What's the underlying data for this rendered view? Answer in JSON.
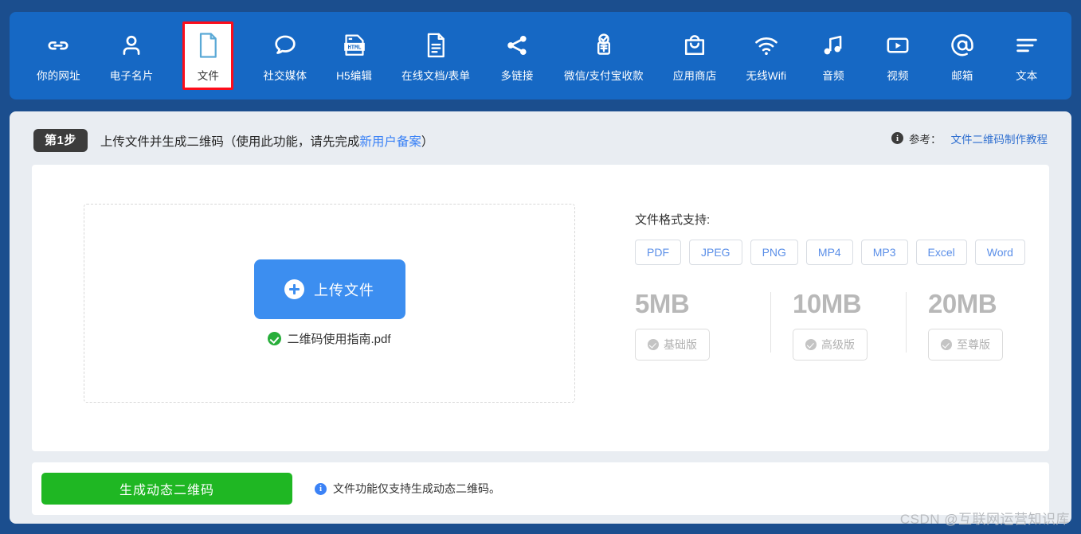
{
  "nav": {
    "items": [
      {
        "label": "你的网址",
        "icon": "link-icon",
        "selected": false
      },
      {
        "label": "电子名片",
        "icon": "person-icon",
        "selected": false
      },
      {
        "label": "文件",
        "icon": "document-icon",
        "selected": true
      },
      {
        "label": "社交媒体",
        "icon": "chat-bubble-icon",
        "selected": false
      },
      {
        "label": "H5编辑",
        "icon": "html-file-icon",
        "selected": false
      },
      {
        "label": "在线文档/表单",
        "icon": "text-document-icon",
        "selected": false
      },
      {
        "label": "多链接",
        "icon": "share-nodes-icon",
        "selected": false
      },
      {
        "label": "微信/支付宝收款",
        "icon": "payment-check-icon",
        "selected": false
      },
      {
        "label": "应用商店",
        "icon": "shopping-bag-icon",
        "selected": false
      },
      {
        "label": "无线Wifi",
        "icon": "wifi-icon",
        "selected": false
      },
      {
        "label": "音频",
        "icon": "music-note-icon",
        "selected": false
      },
      {
        "label": "视频",
        "icon": "video-play-icon",
        "selected": false
      },
      {
        "label": "邮箱",
        "icon": "at-sign-icon",
        "selected": false
      },
      {
        "label": "文本",
        "icon": "text-lines-icon",
        "selected": false
      }
    ]
  },
  "step": {
    "badge": "第1步",
    "title_before": "上传文件并生成二维码（使用此功能，请先完成",
    "title_link": "新用户备案",
    "title_after": "）",
    "reference_label": "参考：",
    "reference_link": "文件二维码制作教程"
  },
  "upload": {
    "button_label": "上传文件",
    "file_name": "二维码使用指南.pdf"
  },
  "formats": {
    "title": "文件格式支持:",
    "chips": [
      "PDF",
      "JPEG",
      "PNG",
      "MP4",
      "MP3",
      "Excel",
      "Word"
    ],
    "tiers": [
      {
        "size": "5MB",
        "plan": "基础版"
      },
      {
        "size": "10MB",
        "plan": "高级版"
      },
      {
        "size": "20MB",
        "plan": "至尊版"
      }
    ]
  },
  "footer": {
    "generate_label": "生成动态二维码",
    "note": "文件功能仅支持生成动态二维码。"
  },
  "watermark": "CSDN @互联网运营知识库",
  "colors": {
    "page_bg": "#1b4e8e",
    "navbar_bg": "#1668c4",
    "panel_bg": "#e9edf2",
    "selected_outline": "#fc0d1b",
    "upload_blue": "#3c8ef0",
    "generate_green": "#1fb723",
    "link_blue": "#3b82f6",
    "chip_text": "#5b8fe8",
    "tier_gray": "#b8b8b8"
  }
}
